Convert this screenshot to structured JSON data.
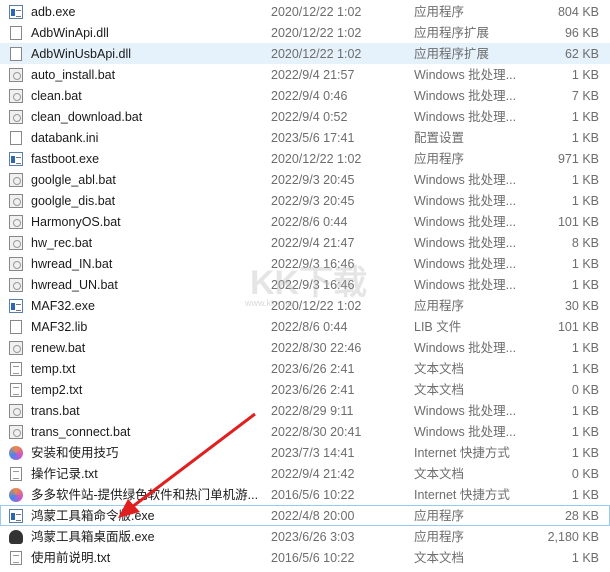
{
  "files": [
    {
      "name": "adb.exe",
      "date": "2020/12/22 1:02",
      "type": "应用程序",
      "size": "804 KB",
      "icon": "exe"
    },
    {
      "name": "AdbWinApi.dll",
      "date": "2020/12/22 1:02",
      "type": "应用程序扩展",
      "size": "96 KB",
      "icon": "doc"
    },
    {
      "name": "AdbWinUsbApi.dll",
      "date": "2020/12/22 1:02",
      "type": "应用程序扩展",
      "size": "62 KB",
      "icon": "doc"
    },
    {
      "name": "auto_install.bat",
      "date": "2022/9/4 21:57",
      "type": "Windows 批处理...",
      "size": "1 KB",
      "icon": "bat"
    },
    {
      "name": "clean.bat",
      "date": "2022/9/4 0:46",
      "type": "Windows 批处理...",
      "size": "7 KB",
      "icon": "bat"
    },
    {
      "name": "clean_download.bat",
      "date": "2022/9/4 0:52",
      "type": "Windows 批处理...",
      "size": "1 KB",
      "icon": "bat"
    },
    {
      "name": "databank.ini",
      "date": "2023/5/6 17:41",
      "type": "配置设置",
      "size": "1 KB",
      "icon": "doc"
    },
    {
      "name": "fastboot.exe",
      "date": "2020/12/22 1:02",
      "type": "应用程序",
      "size": "971 KB",
      "icon": "exe"
    },
    {
      "name": "goolgle_abl.bat",
      "date": "2022/9/3 20:45",
      "type": "Windows 批处理...",
      "size": "1 KB",
      "icon": "bat"
    },
    {
      "name": "goolgle_dis.bat",
      "date": "2022/9/3 20:45",
      "type": "Windows 批处理...",
      "size": "1 KB",
      "icon": "bat"
    },
    {
      "name": "HarmonyOS.bat",
      "date": "2022/8/6 0:44",
      "type": "Windows 批处理...",
      "size": "101 KB",
      "icon": "bat"
    },
    {
      "name": "hw_rec.bat",
      "date": "2022/9/4 21:47",
      "type": "Windows 批处理...",
      "size": "8 KB",
      "icon": "bat"
    },
    {
      "name": "hwread_IN.bat",
      "date": "2022/9/3 16:46",
      "type": "Windows 批处理...",
      "size": "1 KB",
      "icon": "bat"
    },
    {
      "name": "hwread_UN.bat",
      "date": "2022/9/3 16:46",
      "type": "Windows 批处理...",
      "size": "1 KB",
      "icon": "bat"
    },
    {
      "name": "MAF32.exe",
      "date": "2020/12/22 1:02",
      "type": "应用程序",
      "size": "30 KB",
      "icon": "exe"
    },
    {
      "name": "MAF32.lib",
      "date": "2022/8/6 0:44",
      "type": "LIB 文件",
      "size": "101 KB",
      "icon": "doc"
    },
    {
      "name": "renew.bat",
      "date": "2022/8/30 22:46",
      "type": "Windows 批处理...",
      "size": "1 KB",
      "icon": "bat"
    },
    {
      "name": "temp.txt",
      "date": "2023/6/26 2:41",
      "type": "文本文档",
      "size": "1 KB",
      "icon": "txt"
    },
    {
      "name": "temp2.txt",
      "date": "2023/6/26 2:41",
      "type": "文本文档",
      "size": "0 KB",
      "icon": "txt"
    },
    {
      "name": "trans.bat",
      "date": "2022/8/29 9:11",
      "type": "Windows 批处理...",
      "size": "1 KB",
      "icon": "bat"
    },
    {
      "name": "trans_connect.bat",
      "date": "2022/8/30 20:41",
      "type": "Windows 批处理...",
      "size": "1 KB",
      "icon": "bat"
    },
    {
      "name": "安装和使用技巧",
      "date": "2023/7/3 14:41",
      "type": "Internet 快捷方式",
      "size": "1 KB",
      "icon": "lnk"
    },
    {
      "name": "操作记录.txt",
      "date": "2022/9/4 21:42",
      "type": "文本文档",
      "size": "0 KB",
      "icon": "txt"
    },
    {
      "name": "多多软件站-提供绿色软件和热门单机游...",
      "date": "2016/5/6 10:22",
      "type": "Internet 快捷方式",
      "size": "1 KB",
      "icon": "lnk"
    },
    {
      "name": "鸿蒙工具箱命令版.exe",
      "date": "2022/4/8 20:00",
      "type": "应用程序",
      "size": "28 KB",
      "icon": "exe"
    },
    {
      "name": "鸿蒙工具箱桌面版.exe",
      "date": "2023/6/26 3:03",
      "type": "应用程序",
      "size": "2,180 KB",
      "icon": "app"
    },
    {
      "name": "使用前说明.txt",
      "date": "2016/5/6 10:22",
      "type": "文本文档",
      "size": "1 KB",
      "icon": "txt"
    }
  ],
  "hover_index": 2,
  "selected_index": 24,
  "watermark": "KK下载",
  "watermark_sub": "www.kkx.net",
  "arrow_color": "#e02020"
}
